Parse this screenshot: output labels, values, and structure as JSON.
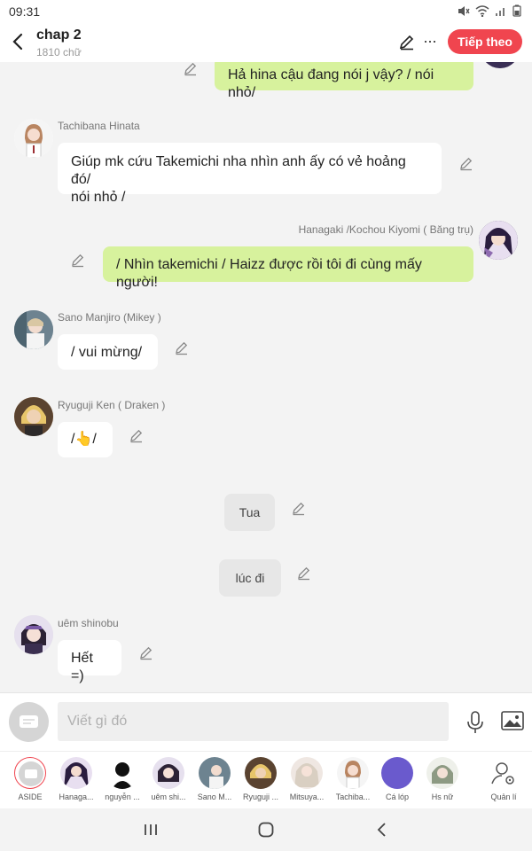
{
  "status": {
    "time": "09:31"
  },
  "header": {
    "title": "chap 2",
    "subtitle": "1810 chữ",
    "more": "···",
    "next_label": "Tiếp theo"
  },
  "messages": [
    {
      "side": "right",
      "text": "Hả hina cậu đang nói j vậy? / nói nhỏ/"
    },
    {
      "side": "left",
      "name": "Tachibana Hinata",
      "line1": "Giúp mk cứu Takemichi nha nhìn anh ấy có vẻ hoảng đó/",
      "line2": "nói nhỏ /"
    },
    {
      "side": "right",
      "name": "Hanagaki /Kochou Kiyomi ( Băng trụ)",
      "text": "/ Nhìn takemichi / Haizz được rồi tôi đi cùng mấy người!"
    },
    {
      "side": "left",
      "name": "Sano Manjiro (Mikey )",
      "text": "/ vui mừng/"
    },
    {
      "side": "left",
      "name": "Ryuguji Ken ( Draken )",
      "text": "/👆/"
    },
    {
      "side": "center",
      "text": "Tua"
    },
    {
      "side": "center",
      "text": "lúc đi"
    },
    {
      "side": "left",
      "name": "uêm shinobu",
      "text": "Hết =)"
    }
  ],
  "input": {
    "placeholder": "Viết gì đó"
  },
  "characters": [
    {
      "label": "ASIDE"
    },
    {
      "label": "Hanaga..."
    },
    {
      "label": "nguyễn ..."
    },
    {
      "label": "uêm shi..."
    },
    {
      "label": "Sano M..."
    },
    {
      "label": "Ryuguji ..."
    },
    {
      "label": "Mitsuya..."
    },
    {
      "label": "Tachiba..."
    },
    {
      "label": "Cá lóp"
    },
    {
      "label": "Hs nữ"
    },
    {
      "label": "Quản lí"
    }
  ],
  "colors": {
    "accent": "#f0454f",
    "green_bubble": "#d7f29d",
    "purple_avatar": "#6a5acd"
  },
  "icons": {
    "back": "chevron-left-icon",
    "edit": "pencil-icon",
    "more": "more-icon",
    "mic": "mic-icon",
    "image": "image-icon"
  }
}
